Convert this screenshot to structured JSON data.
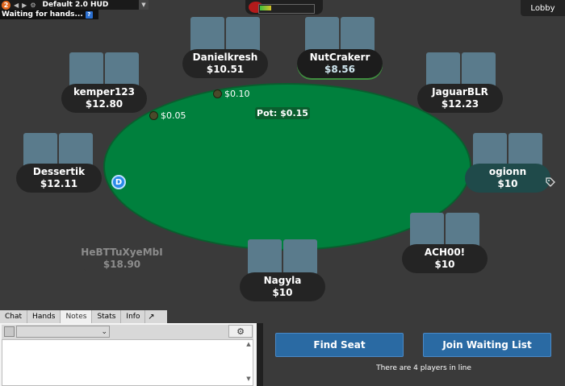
{
  "hud": {
    "badge": "2",
    "title": "Default 2.0 HUD",
    "waiting": "Waiting for hands...",
    "help": "?"
  },
  "lobby": "Lobby",
  "pot": "Pot: $0.15",
  "bets": {
    "sb": "$0.05",
    "bb": "$0.10"
  },
  "dealer": "D",
  "seats": [
    {
      "name": "Danielkresh",
      "stack": "$10.51"
    },
    {
      "name": "NutCrakerr",
      "stack": "$8.56"
    },
    {
      "name": "kemper123",
      "stack": "$12.80"
    },
    {
      "name": "JaguarBLR",
      "stack": "$12.23"
    },
    {
      "name": "Dessertik",
      "stack": "$12.11"
    },
    {
      "name": "ogionn",
      "stack": "$10"
    },
    {
      "name": "ACH00!",
      "stack": "$10"
    },
    {
      "name": "HeBTTuXyeMbI",
      "stack": "$18.90"
    },
    {
      "name": "Nagyla",
      "stack": "$10"
    }
  ],
  "tabs": [
    "Chat",
    "Hands",
    "Notes",
    "Stats",
    "Info"
  ],
  "active_tab": "Notes",
  "buttons": {
    "find_seat": "Find Seat",
    "join_waiting": "Join Waiting List"
  },
  "waiting_line": "There are 4 players in line",
  "icons": [
    "gear-icon",
    "chevron-down-icon",
    "expand-icon",
    "tag-icon"
  ],
  "colors": {
    "felt": "#00803d",
    "button": "#2a6aa3",
    "card_back": "#5a7b8c"
  }
}
